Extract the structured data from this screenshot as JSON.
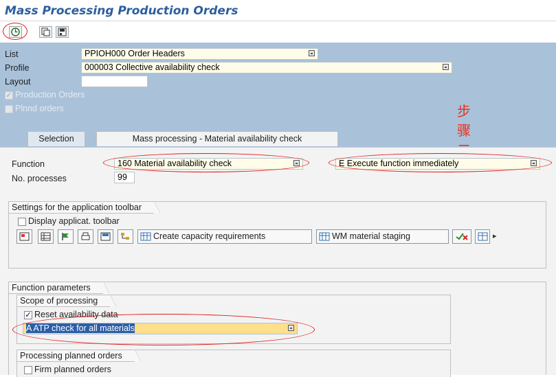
{
  "window": {
    "title": "Mass Processing Production Orders"
  },
  "toolbar": {
    "buttons": [
      "execute-icon",
      "copy-icon",
      "save-variant-icon"
    ]
  },
  "header": {
    "list_label": "List",
    "list_value": "PPIOH000 Order Headers",
    "profile_label": "Profile",
    "profile_value": "000003 Collective availability check",
    "layout_label": "Layout",
    "layout_value": "",
    "production_orders_label": "Production Orders",
    "plnnd_orders_label": "Plnnd orders"
  },
  "annotation": {
    "text": "步骤二"
  },
  "tabs": {
    "selection": "Selection",
    "mass_processing": "Mass processing - Material availability check"
  },
  "main": {
    "function_label": "Function",
    "function_value": "160 Material availability check",
    "execution_value": "E Execute function immediately",
    "processes_label": "No. processes",
    "processes_value": "99"
  },
  "app_toolbar": {
    "group_title": "Settings for the application toolbar",
    "display_label": "Display applicat. toolbar",
    "create_capacity": "Create capacity requirements",
    "wm_staging": "WM material staging"
  },
  "function_params": {
    "group_title": "Function parameters",
    "scope_title": "Scope of processing",
    "reset_label": "Reset availability data",
    "atp_value": "A ATP check for all materials",
    "planned_title": "Processing planned orders",
    "firm_label": "Firm planned orders"
  },
  "colors": {
    "header_bg": "#a9c1d9",
    "title": "#2c5e9e",
    "highlight": "#ffdf8c",
    "annotation": "#e8311e"
  }
}
